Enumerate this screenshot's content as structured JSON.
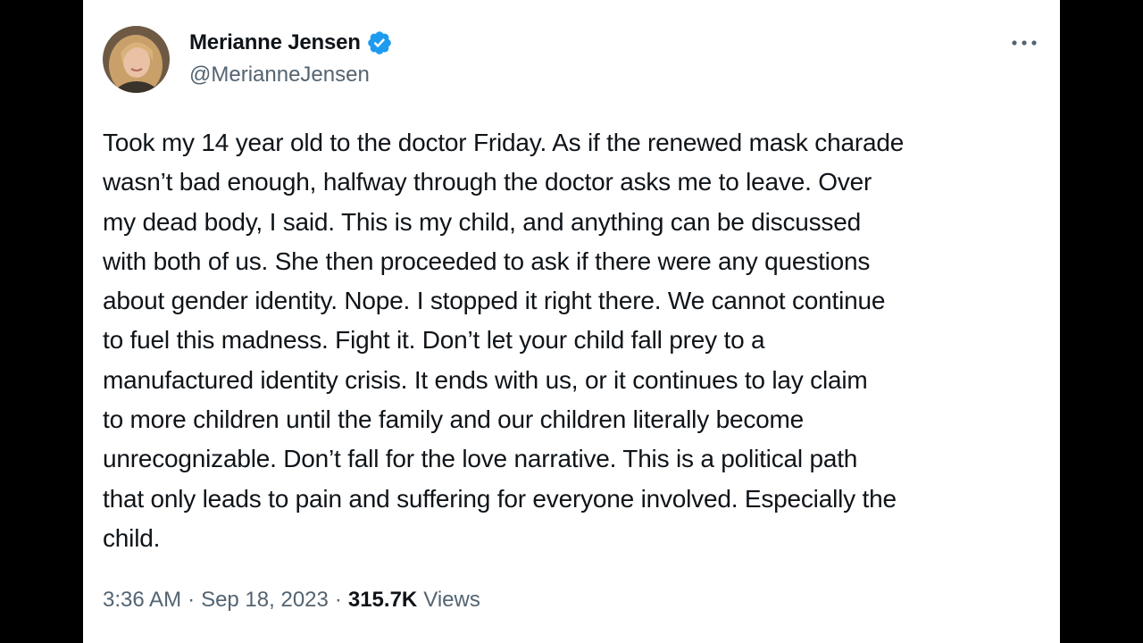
{
  "author": {
    "display_name": "Merianne Jensen",
    "handle": "@MerianneJensen",
    "verified": true
  },
  "tweet": {
    "text": "Took my 14 year old to the doctor Friday. As if the renewed mask charade\nwasn’t bad enough, halfway through the doctor asks me to leave. Over\nmy dead body, I said. This is my child, and anything can be discussed\nwith both of us. She then proceeded to ask if there were any questions\nabout gender identity. Nope. I stopped it right there. We cannot continue\nto fuel this madness. Fight it. Don’t let your child fall prey to a\nmanufactured identity crisis. It ends with us, or it continues to lay claim\nto more children until the family and our children literally become\nunrecognizable. Don’t fall for the love narrative. This is a political path\nthat only leads to pain and suffering for everyone involved. Especially the\nchild."
  },
  "meta": {
    "time": "3:36 AM",
    "separator": "·",
    "date": "Sep 18, 2023",
    "views_count": "315.7K",
    "views_label": "Views"
  },
  "icons": {
    "verified": "verified-badge-icon",
    "more": "more-options-icon"
  },
  "colors": {
    "verified_blue": "#1d9bf0",
    "text_primary": "#0f1419",
    "text_secondary": "#536471",
    "background": "#ffffff",
    "frame": "#000000"
  }
}
